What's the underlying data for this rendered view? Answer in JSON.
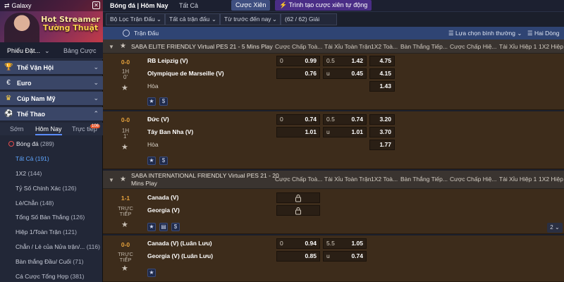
{
  "brand": {
    "app": "Galaxy",
    "promo_line1": "Hot Streamer",
    "promo_line2": "Tường Thuật"
  },
  "sidebar": {
    "tabs": [
      "Phiếu Đặt...",
      "Bảng Cược"
    ],
    "categories": [
      {
        "label": "Thể Vận Hội",
        "icon": "trophy-icon"
      },
      {
        "label": "Euro",
        "icon": "euro-icon"
      },
      {
        "label": "Cúp Nam Mỹ",
        "icon": "cup-icon"
      },
      {
        "label": "Thể Thao",
        "icon": "soccer-icon"
      }
    ],
    "subtabs": [
      "Sớm",
      "Hôm Nay",
      "Trực tiếp"
    ],
    "live_badge": "106",
    "menu_head": {
      "label": "Bóng đá",
      "count": "(289)"
    },
    "menu": [
      {
        "label": "Tất Cả",
        "count": "(191)"
      },
      {
        "label": "1X2",
        "count": "(144)"
      },
      {
        "label": "Tỷ Số Chính Xác",
        "count": "(126)"
      },
      {
        "label": "Lẻ/Chẵn",
        "count": "(148)"
      },
      {
        "label": "Tổng Số Bàn Thắng",
        "count": "(126)"
      },
      {
        "label": "Hiệp 1/Toàn Trận",
        "count": "(121)"
      },
      {
        "label": "Chẵn / Lẻ của Nửa trận/...",
        "count": "(116)"
      },
      {
        "label": "Bàn thắng Đầu/ Cuối",
        "count": "(71)"
      },
      {
        "label": "Cá Cược Tổng Hợp",
        "count": "(381)"
      }
    ]
  },
  "toolbar": {
    "title": "Bóng đá | Hôm Nay",
    "dropdown": "Tất Cả",
    "parlay_button": "Cược Xiên",
    "auto_parlay_button": "Trình tạo cược xiên tự động",
    "filters": [
      "Bộ Lọc Trận Đấu",
      "Tất cả trận đấu",
      "Từ trước đến nay",
      "(62 / 62) Giải"
    ]
  },
  "table": {
    "header_label": "Trận Đấu",
    "sort_option": "Lựa chọn bình thường",
    "view_option": "Hai Dòng",
    "columns": [
      "Cược Chấp Toà...",
      "Tài Xỉu Toàn Trận",
      "1X2 Toà...",
      "Bàn Thắng Tiếp...",
      "Cược Chấp Hiệ...",
      "Tài Xỉu Hiệp 1",
      "1X2 Hiệp 1"
    ],
    "leagues": [
      {
        "name": "SABA ELITE FRIENDLY Virtual PES 21 - 5 Mins Play",
        "matches": [
          {
            "score": "0-0",
            "period": "1H",
            "minute": "0'",
            "home": "RB Leipzig (V)",
            "away": "Olympique de Marseille (V)",
            "draw": "Hòa",
            "hdp_line": "0",
            "hdp_home": "0.99",
            "hdp_away": "0.76",
            "ou_line": "0.5",
            "ou_over": "1.42",
            "ou_under_label": "u",
            "ou_under": "0.45",
            "x12_home": "4.75",
            "x12_away": "4.15",
            "x12_draw": "1.43"
          },
          {
            "score": "0-0",
            "period": "1H",
            "minute": "1'",
            "home": "Đức (V)",
            "away": "Tây Ban Nha (V)",
            "draw": "Hòa",
            "hdp_line": "0",
            "hdp_home": "0.74",
            "hdp_away": "1.01",
            "ou_line": "0.5",
            "ou_over": "0.74",
            "ou_under_label": "u",
            "ou_under": "1.01",
            "x12_home": "3.20",
            "x12_away": "3.70",
            "x12_draw": "1.77"
          }
        ]
      },
      {
        "name_line1": "SABA INTERNATIONAL FRIENDLY Virtual PES 21 - 20",
        "name_line2": "Mins Play",
        "matches": [
          {
            "score": "1-1",
            "live1": "TRỰC",
            "live2": "TIẾP",
            "home": "Canada (V)",
            "away": "Georgia (V)"
          },
          {
            "score": "0-0",
            "live1": "TRỰC",
            "live2": "TIẾP",
            "home": "Canada (V) (Luân Lưu)",
            "away": "Georgia (V) (Luân Lưu)",
            "hdp_line": "0",
            "hdp_home": "0.94",
            "hdp_away": "0.85",
            "ou_line": "5.5",
            "ou_over": "1.05",
            "ou_under_label": "u",
            "ou_under": "0.74"
          }
        ]
      }
    ],
    "page_indicator": "2"
  }
}
